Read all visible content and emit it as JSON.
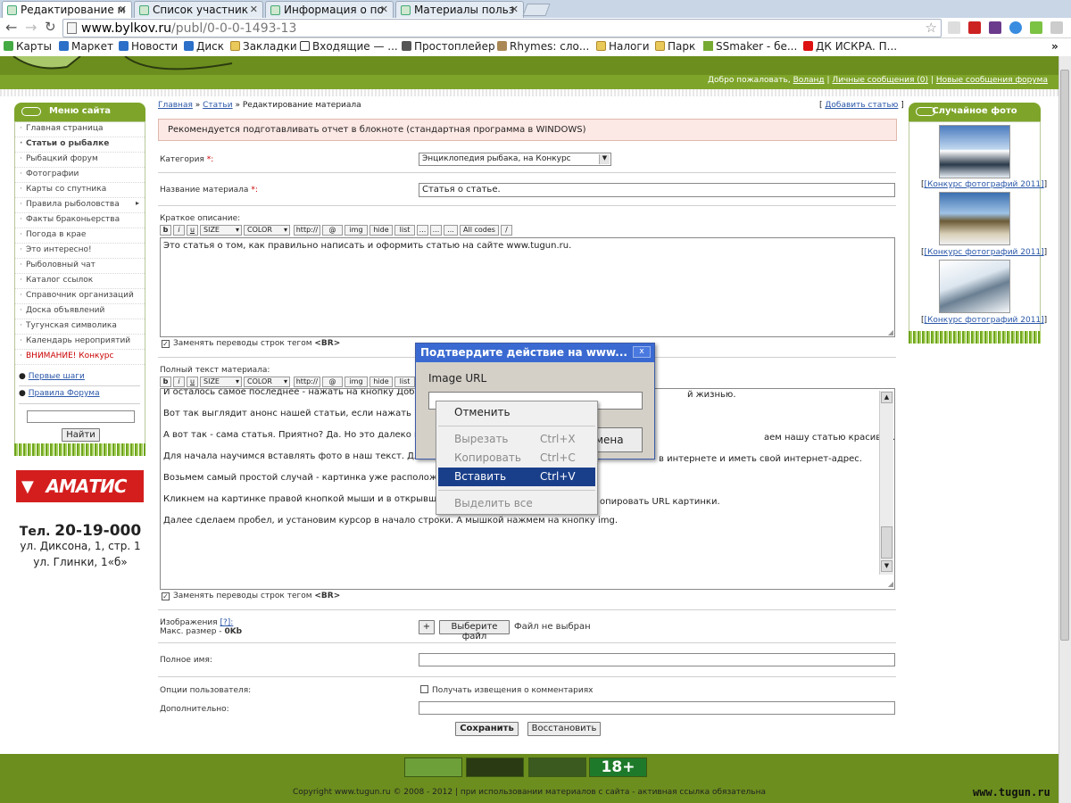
{
  "browser": {
    "tabs": [
      {
        "label": "Редактирование м"
      },
      {
        "label": "Список участник"
      },
      {
        "label": "Информация о по"
      },
      {
        "label": "Материалы польз"
      }
    ],
    "url_host": "www.bylkov.ru",
    "url_path": "/publ/0-0-0-1493-13",
    "bookmarks": [
      "Карты",
      "Маркет",
      "Новости",
      "Диск",
      "Закладки",
      "Входящие — ...",
      "Простоплейер",
      "Rhymes: сло...",
      "Налоги",
      "Парк",
      "SSmaker - бе...",
      "ДК ИСКРА. П..."
    ]
  },
  "site": {
    "welcome": "Добро пожаловать,",
    "user": "Воланд",
    "sep1": "|",
    "pm": "Личные сообщения (0)",
    "sep2": "|",
    "new_forum": "Новые сообщения форума"
  },
  "left_menu": {
    "title": "Меню сайта",
    "items": [
      "Главная страница",
      "Статьи о рыбалке",
      "Рыбацкий форум",
      "Фотографии",
      "Карты со спутника",
      "Правила рыболовства",
      "Факты браконьерства",
      "Погода в крае",
      "Это интересно!",
      "Рыболовный чат",
      "Каталог ссылок",
      "Справочник организаций",
      "Доска объявлений",
      "Тугунская символика",
      "Календарь нероприятий",
      "ВНИМАНИЕ! Конкурс"
    ],
    "extra_links": [
      "Первые шаги",
      "Правила Форума"
    ],
    "search_button": "Найти"
  },
  "ad": {
    "brand": "АМАТИС",
    "phone_prefix": "Тел.",
    "phone": "20-19-000",
    "addr1": "ул. Диксона, 1, стр. 1",
    "addr2": "ул. Глинки, 1«б»"
  },
  "breadcrumb": {
    "home": "Главная",
    "sep": "»",
    "articles": "Статьи",
    "current": "Редактирование материала",
    "add_article": "Добавить статью"
  },
  "form": {
    "notice": "Рекомендуется подготавливать отчет в блокноте (стандартная программа в WINDOWS)",
    "category_label": "Категория",
    "required_mark": "*:",
    "category_value": "Энциклопедия рыбака, на Конкурс",
    "title_label": "Название материала",
    "title_value": "Статья о статье.",
    "short_label": "Краткое описание:",
    "short_text": "Это статья о том, как правильно написать и оформить статью на сайте www.tugun.ru.",
    "replace_br": "Заменять переводы строк тегом",
    "br_tag": "<BR>",
    "full_label": "Полный текст материала:",
    "full_lines": [
      "И осталось самое последнее - нажать на кнопку Добав...",
      "Вот так выглядит анонс нашей статьи, если нажать на",
      "А вот так - сама статья. Приятно? Да. Но это далеко н",
      "Для начала научимся вставлять фото в наш текст. Для",
      "Возьмем самый простой случай - картинка уже располож",
      "Кликнем на картинке правой кнопкой мыши и в открывшем",
      "Далее сделаем пробел, и установим курсор в начало строки. А мышкой нажмем на кнопку img."
    ],
    "full_right_fragments": [
      "й жизнью.",
      "аем нашу статью красивой.",
      "в интернете и иметь свой интернет-адрес.",
      "опировать URL картинки."
    ],
    "bbcodes": [
      "b",
      "i",
      "u",
      "SIZE",
      "COLOR",
      "http://",
      "@",
      "img",
      "hide",
      "list",
      "...",
      "...",
      "...",
      "All codes",
      "/"
    ],
    "images_label": "Изображения",
    "images_help": "[?]:",
    "max_size": "Макс. размер -",
    "max_value": "0Kb",
    "plus": "+",
    "choose_file": "Выберите файл",
    "no_file": "Файл не выбран",
    "fullname_label": "Полное имя:",
    "options_label": "Опции пользователя:",
    "notify_label": "Получать извещения о комментариях",
    "extra_label": "Дополнительно:",
    "save": "Сохранить",
    "restore": "Восстановить"
  },
  "dialog": {
    "title": "Подтвердите действие на www...",
    "close": "x",
    "field_label": "Image URL",
    "cancel_fragment": "мена"
  },
  "context_menu": {
    "cancel": "Отменить",
    "cut": "Вырезать",
    "cut_sc": "Ctrl+X",
    "copy": "Копировать",
    "copy_sc": "Ctrl+C",
    "paste": "Вставить",
    "paste_sc": "Ctrl+V",
    "select_all": "Выделить все"
  },
  "random_photo": {
    "title": "Случайное фото",
    "captions": [
      "[Конкурс фотографий 2011]",
      "[Конкурс фотографий 2011]",
      "[Конкурс фотографий 2011]"
    ]
  },
  "footer": {
    "copyright": "Copyright www.tugun.ru © 2008 - 2012 | при использовании материалов с сайта - активная ссылка обязательна",
    "age": "18+",
    "watermark": "www.tugun.ru"
  }
}
